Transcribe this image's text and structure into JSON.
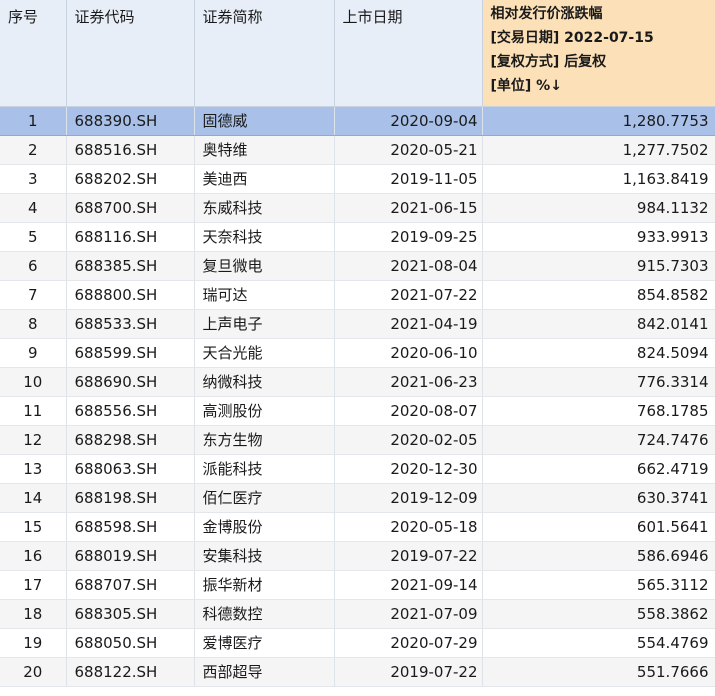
{
  "columns": {
    "idx": "序号",
    "code": "证券代码",
    "name": "证券简称",
    "date": "上市日期",
    "change": {
      "line1": "相对发行价涨跌幅",
      "line2": "[交易日期] 2022-07-15",
      "line3": "[复权方式] 后复权",
      "line4": "[单位] %↓"
    }
  },
  "rows": [
    {
      "idx": "1",
      "code": "688390.SH",
      "name": "固德威",
      "date": "2020-09-04",
      "change": "1,280.7753",
      "selected": true
    },
    {
      "idx": "2",
      "code": "688516.SH",
      "name": "奥特维",
      "date": "2020-05-21",
      "change": "1,277.7502"
    },
    {
      "idx": "3",
      "code": "688202.SH",
      "name": "美迪西",
      "date": "2019-11-05",
      "change": "1,163.8419"
    },
    {
      "idx": "4",
      "code": "688700.SH",
      "name": "东威科技",
      "date": "2021-06-15",
      "change": "984.1132"
    },
    {
      "idx": "5",
      "code": "688116.SH",
      "name": "天奈科技",
      "date": "2019-09-25",
      "change": "933.9913"
    },
    {
      "idx": "6",
      "code": "688385.SH",
      "name": "复旦微电",
      "date": "2021-08-04",
      "change": "915.7303"
    },
    {
      "idx": "7",
      "code": "688800.SH",
      "name": "瑞可达",
      "date": "2021-07-22",
      "change": "854.8582"
    },
    {
      "idx": "8",
      "code": "688533.SH",
      "name": "上声电子",
      "date": "2021-04-19",
      "change": "842.0141"
    },
    {
      "idx": "9",
      "code": "688599.SH",
      "name": "天合光能",
      "date": "2020-06-10",
      "change": "824.5094"
    },
    {
      "idx": "10",
      "code": "688690.SH",
      "name": "纳微科技",
      "date": "2021-06-23",
      "change": "776.3314"
    },
    {
      "idx": "11",
      "code": "688556.SH",
      "name": "高测股份",
      "date": "2020-08-07",
      "change": "768.1785"
    },
    {
      "idx": "12",
      "code": "688298.SH",
      "name": "东方生物",
      "date": "2020-02-05",
      "change": "724.7476"
    },
    {
      "idx": "13",
      "code": "688063.SH",
      "name": "派能科技",
      "date": "2020-12-30",
      "change": "662.4719"
    },
    {
      "idx": "14",
      "code": "688198.SH",
      "name": "佰仁医疗",
      "date": "2019-12-09",
      "change": "630.3741"
    },
    {
      "idx": "15",
      "code": "688598.SH",
      "name": "金博股份",
      "date": "2020-05-18",
      "change": "601.5641"
    },
    {
      "idx": "16",
      "code": "688019.SH",
      "name": "安集科技",
      "date": "2019-07-22",
      "change": "586.6946"
    },
    {
      "idx": "17",
      "code": "688707.SH",
      "name": "振华新材",
      "date": "2021-09-14",
      "change": "565.3112"
    },
    {
      "idx": "18",
      "code": "688305.SH",
      "name": "科德数控",
      "date": "2021-07-09",
      "change": "558.3862"
    },
    {
      "idx": "19",
      "code": "688050.SH",
      "name": "爱博医疗",
      "date": "2020-07-29",
      "change": "554.4769"
    },
    {
      "idx": "20",
      "code": "688122.SH",
      "name": "西部超导",
      "date": "2019-07-22",
      "change": "551.7666"
    }
  ]
}
